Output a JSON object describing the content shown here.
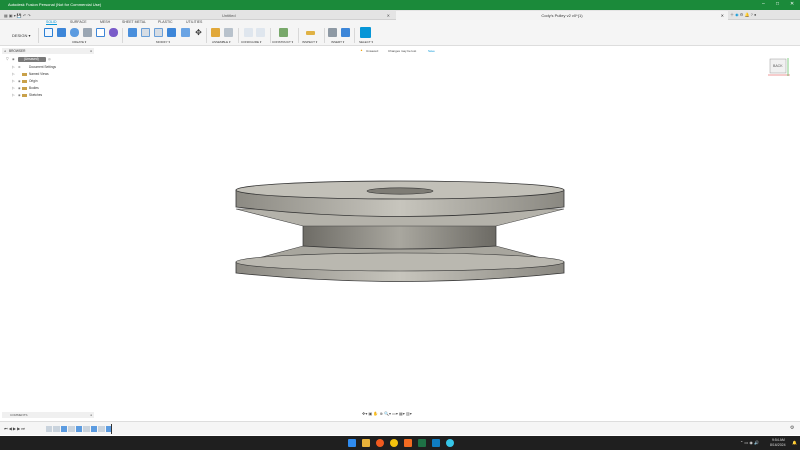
{
  "window": {
    "title": "Autodesk Fusion Personal (Not for Commercial Use)",
    "controls": [
      "–",
      "□",
      "✕"
    ]
  },
  "doc_tabs": [
    {
      "label": "Untitled",
      "active": false
    },
    {
      "label": "Cody's Pulley v2 v0*(1)",
      "active": true
    }
  ],
  "ribbon": {
    "workspace": "DESIGN ▾",
    "tabs": [
      "SOLID",
      "SURFACE",
      "MESH",
      "SHEET METAL",
      "PLASTIC",
      "UTILITIES"
    ],
    "active_tab": "SOLID",
    "groups": [
      "CREATE ▾",
      "MODIFY ▾",
      "ASSEMBLE ▾",
      "CONFIGURE ▾",
      "CONSTRUCT ▾",
      "INSPECT ▾",
      "INSERT ▾",
      "SELECT ▾"
    ]
  },
  "browser": {
    "title": "BROWSER",
    "root": "(Unsaved)",
    "items": [
      "Document Settings",
      "Named Views",
      "Origin",
      "Bodies",
      "Sketches"
    ]
  },
  "warning": {
    "label": "Unsaved:",
    "message": "Changes may be lost",
    "action": "Save"
  },
  "viewcube": {
    "face": "BACK"
  },
  "comments": {
    "label": "COMMENTS"
  },
  "taskbar": {
    "time": "9:54 AM",
    "date": "8/16/2024"
  },
  "colors": {
    "title_bar": "#1b8a3a",
    "accent": "#0696d7",
    "warning": "#f0a30a"
  }
}
